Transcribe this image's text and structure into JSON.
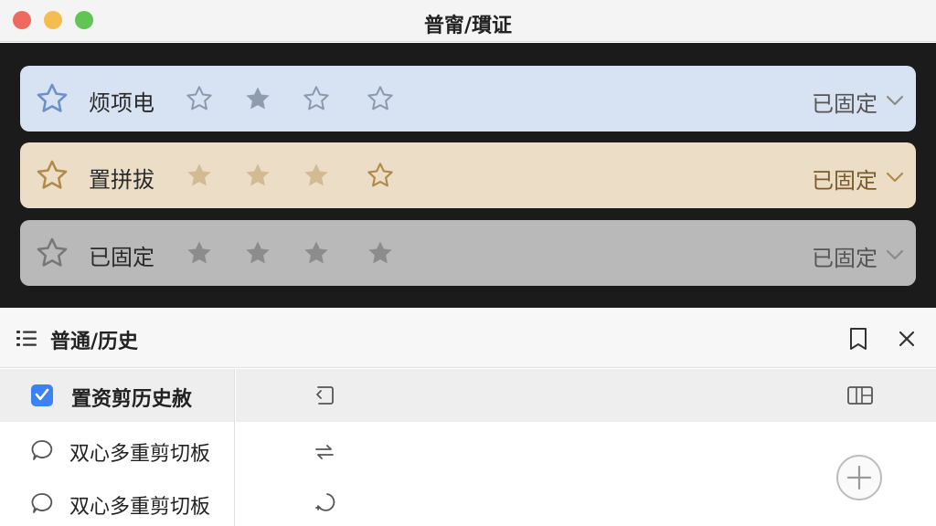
{
  "window": {
    "title": "普甯/瑻证"
  },
  "cards": [
    {
      "label": "烦项电",
      "status": "已固定",
      "theme": "blue",
      "accent": "#6b8fc9",
      "star_color": "#8a99b0"
    },
    {
      "label": "置拼拔",
      "status": "已固定",
      "theme": "tan",
      "accent": "#b08a4a",
      "star_color": "#c8ae82"
    },
    {
      "label": "已固定",
      "status": "已固定",
      "theme": "gray",
      "accent": "#777777",
      "star_color": "#888888"
    }
  ],
  "lower": {
    "title": "普通/历史",
    "items": [
      {
        "label": "置资剪历史赦",
        "icon": "checkbox-checked-icon",
        "selected": true
      },
      {
        "label": "双心多重剪切板",
        "icon": "chat-bubble-icon",
        "selected": false
      },
      {
        "label": "双心多重剪切板",
        "icon": "chat-bubble-icon",
        "selected": false
      }
    ]
  },
  "colors": {
    "checkbox": "#3b82f6",
    "dark_bg": "#1b1b1b"
  }
}
